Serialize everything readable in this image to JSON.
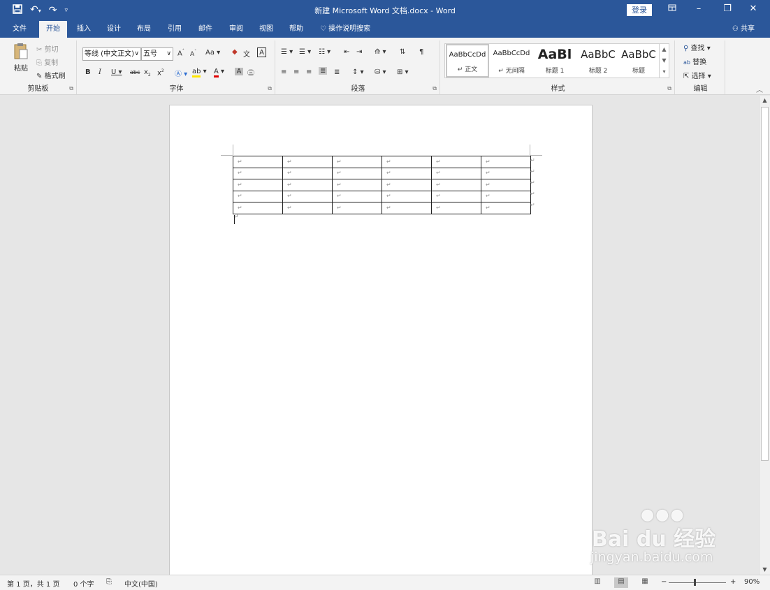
{
  "titlebar": {
    "title": "新建 Microsoft Word 文档.docx  -  Word",
    "login_label": "登录",
    "qat": {
      "save_icon": "save-icon",
      "undo_icon": "undo-icon",
      "redo_icon": "redo-icon",
      "customize_icon": "customize-icon"
    }
  },
  "tabs": [
    {
      "label": "文件"
    },
    {
      "label": "开始"
    },
    {
      "label": "插入"
    },
    {
      "label": "设计"
    },
    {
      "label": "布局"
    },
    {
      "label": "引用"
    },
    {
      "label": "邮件"
    },
    {
      "label": "审阅"
    },
    {
      "label": "视图"
    },
    {
      "label": "帮助"
    },
    {
      "label": "操作说明搜索"
    }
  ],
  "share_label": "共享",
  "clipboard": {
    "paste": "粘贴",
    "cut": "剪切",
    "copy": "复制",
    "format_painter": "格式刷",
    "group_label": "剪贴板"
  },
  "font": {
    "font_name": "等线 (中文正文)",
    "font_size": "五号",
    "change_case": "Aa",
    "group_label": "字体"
  },
  "paragraph": {
    "group_label": "段落"
  },
  "styles": {
    "group_label": "样式",
    "items": [
      {
        "preview": "AaBbCcDd",
        "name": "↵ 正文"
      },
      {
        "preview": "AaBbCcDd",
        "name": "↵ 无间隔"
      },
      {
        "preview": "AaBl",
        "name": "标题 1"
      },
      {
        "preview": "AaBbC",
        "name": "标题 2"
      },
      {
        "preview": "AaBbC",
        "name": "标题"
      }
    ]
  },
  "editing": {
    "find": "查找",
    "replace": "替换",
    "select": "选择",
    "group_label": "编辑"
  },
  "document": {
    "cell_mark": "↵",
    "rows": [
      [
        "↵",
        "↵",
        "↵",
        "↵",
        "↵",
        "↵"
      ],
      [
        "↵",
        "↵",
        "↵",
        "↵",
        "↵",
        "↵"
      ],
      [
        "↵",
        "↵",
        "↵",
        "↵",
        "↵",
        "↵"
      ],
      [
        "↵",
        "↵",
        "↵",
        "↵",
        "↵",
        "↵"
      ],
      [
        "↵",
        "↵",
        "↵",
        "↵",
        "↵",
        "↵"
      ]
    ]
  },
  "statusbar": {
    "page": "第 1 页，共 1 页",
    "words": "0 个字",
    "language": "中文(中国)",
    "zoom": "90%",
    "zoom_minus": "−",
    "zoom_plus": "+"
  },
  "watermark": {
    "main": "Bai du 经验",
    "sub": "jingyan.baidu.com"
  },
  "colors": {
    "brand": "#2b579a",
    "ribbon": "#f3f3f3",
    "canvas": "#e6e6e6"
  }
}
